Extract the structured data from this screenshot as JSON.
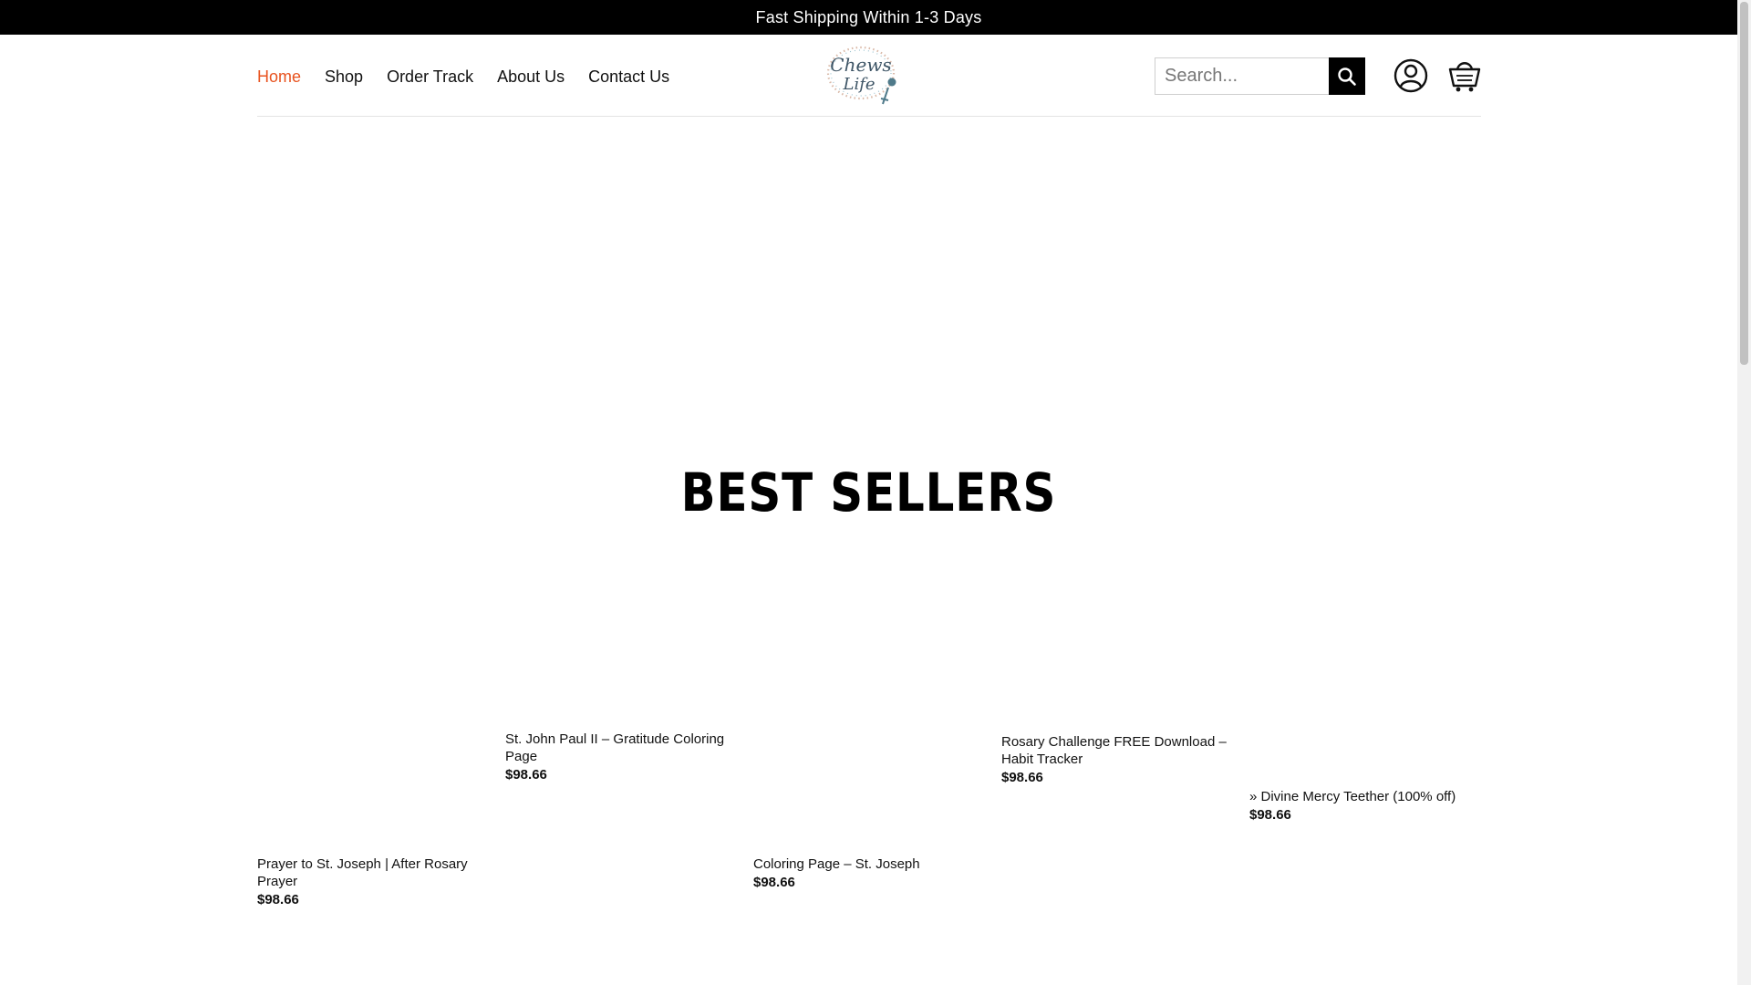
{
  "announcement": "Fast Shipping Within 1-3 Days",
  "nav": {
    "items": [
      {
        "label": "Home",
        "active": true
      },
      {
        "label": "Shop",
        "active": false
      },
      {
        "label": "Order Track",
        "active": false
      },
      {
        "label": "About Us",
        "active": false
      },
      {
        "label": "Contact Us",
        "active": false
      }
    ]
  },
  "logo": {
    "line1": "Chews",
    "line2": "Life"
  },
  "search": {
    "placeholder": "Search..."
  },
  "icons": {
    "search": "search-icon",
    "account": "user-account-icon",
    "cart": "shopping-basket-icon"
  },
  "colors": {
    "accent": "#e8531f",
    "topbar": "#000000",
    "text": "#111111"
  },
  "best_sellers": {
    "title": "BEST SELLERS",
    "products": [
      {
        "name": "Prayer to St. Joseph | After Rosary Prayer",
        "price": "$98.66"
      },
      {
        "name": "St. John Paul II – Gratitude Coloring Page",
        "price": "$98.66"
      },
      {
        "name": "Coloring Page – St. Joseph",
        "price": "$98.66"
      },
      {
        "name": "Rosary Challenge FREE Download – Habit Tracker",
        "price": "$98.66"
      },
      {
        "name": "» Divine Mercy Teether (100% off)",
        "price": "$98.66"
      }
    ]
  }
}
